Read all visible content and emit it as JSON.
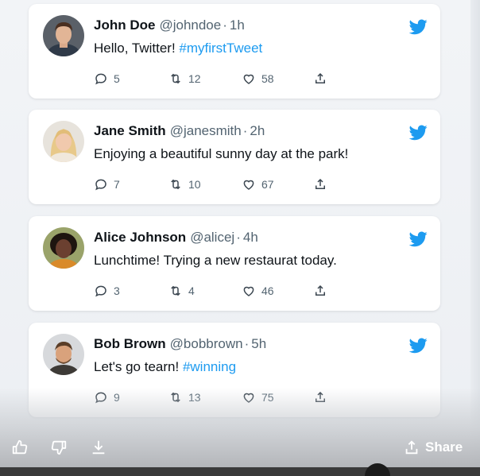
{
  "tweets": [
    {
      "name": "John Doe",
      "handle": "@johndoe",
      "time": "1h",
      "text": "Hello, Twitter! ",
      "hashtag": "#myfirstTweet",
      "replies": "5",
      "retweets": "12",
      "likes": "58"
    },
    {
      "name": "Jane Smith",
      "handle": "@janesmith",
      "time": "2h",
      "text": "Enjoying a beautiful sunny day at the park!",
      "hashtag": "",
      "replies": "7",
      "retweets": "10",
      "likes": "67"
    },
    {
      "name": "Alice Johnson",
      "handle": "@alicej",
      "time": "4h",
      "text": "Lunchtime! Trying a new restaurat today.",
      "hashtag": "",
      "replies": "3",
      "retweets": "4",
      "likes": "46"
    },
    {
      "name": "Bob Brown",
      "handle": "@bobbrown",
      "time": "5h",
      "text": "Let's go tearn! ",
      "hashtag": "#winning",
      "replies": "9",
      "retweets": "13",
      "likes": "75"
    }
  ],
  "bottom_bar": {
    "share_label": "Share"
  },
  "colors": {
    "accent": "#1d9bf0",
    "text": "#0f1419",
    "muted": "#536471"
  },
  "icons": [
    "twitter-bird-icon",
    "reply-icon",
    "retweet-icon",
    "like-icon",
    "share-icon",
    "thumbs-up-icon",
    "thumbs-down-icon",
    "download-icon"
  ]
}
